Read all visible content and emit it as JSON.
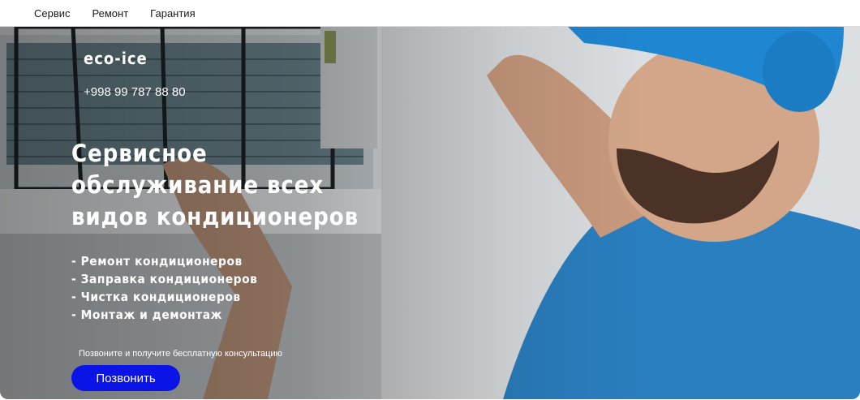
{
  "nav": {
    "items": [
      {
        "label": "Сервис"
      },
      {
        "label": "Ремонт"
      },
      {
        "label": "Гарантия"
      }
    ]
  },
  "hero": {
    "brand": "eco-ice",
    "phone": "+998 99 787 88 80",
    "headline": [
      "Сервисное",
      "обслуживание всех",
      "видов кондиционеров"
    ],
    "services": [
      "- Ремонт кондиционеров",
      "- Заправка кондиционеров",
      "- Чистка кондиционеров",
      "- Монтаж и демонтаж"
    ],
    "cta_caption": "Позвоните и получите бесплатную консультацию",
    "cta_button": "Позвонить",
    "accent_color": "#0a14e6"
  }
}
